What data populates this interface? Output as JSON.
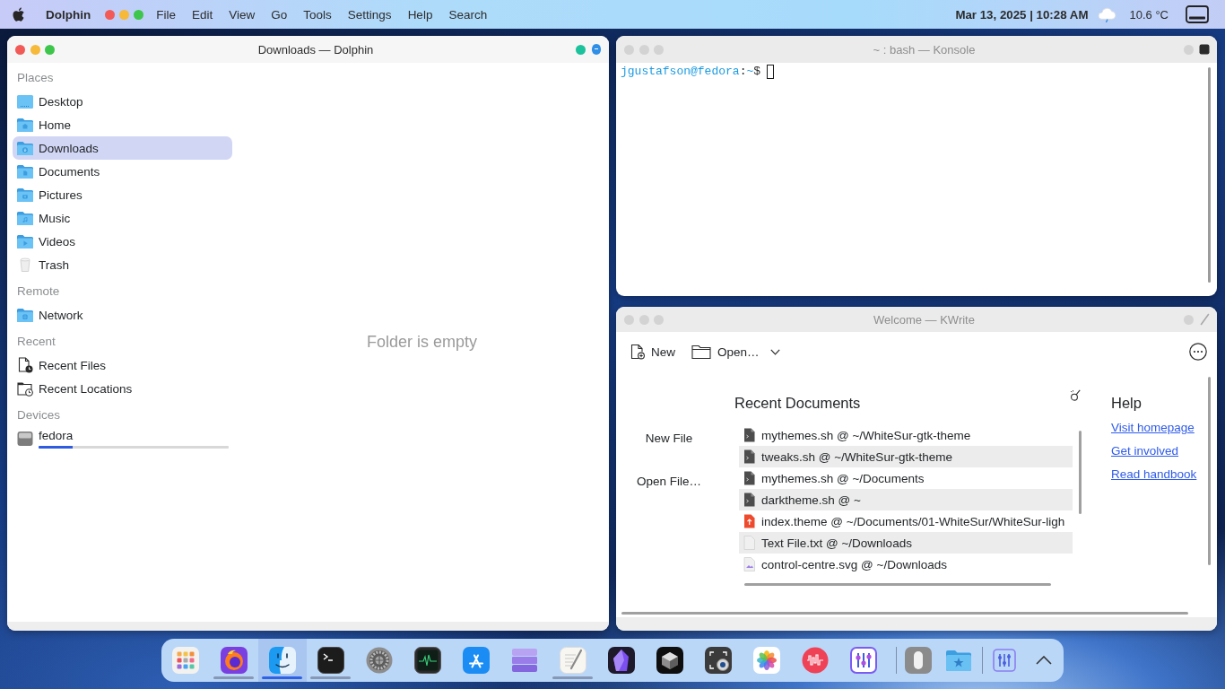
{
  "menu_bar": {
    "app_name": "Dolphin",
    "menus": [
      "File",
      "Edit",
      "View",
      "Go",
      "Tools",
      "Settings",
      "Help",
      "Search"
    ],
    "clock": "Mar 13, 2025 | 10:28 AM",
    "temperature": "10.6 °C"
  },
  "windows": [
    {
      "kind": "files",
      "title": "Downloads — Dolphin",
      "active": true,
      "sidebar": [
        {
          "heading": "Places",
          "items": [
            {
              "kind": "desktop",
              "label": "Desktop",
              "selected": false
            },
            {
              "kind": "home",
              "label": "Home",
              "selected": false
            },
            {
              "kind": "downloads",
              "label": "Downloads",
              "selected": true
            },
            {
              "kind": "documents",
              "label": "Documents",
              "selected": false
            },
            {
              "kind": "pictures",
              "label": "Pictures",
              "selected": false
            },
            {
              "kind": "music",
              "label": "Music",
              "selected": false
            },
            {
              "kind": "videos",
              "label": "Videos",
              "selected": false
            },
            {
              "kind": "trash",
              "label": "Trash",
              "selected": false
            }
          ]
        },
        {
          "heading": "Remote",
          "items": [
            {
              "kind": "network",
              "label": "Network",
              "selected": false
            }
          ]
        },
        {
          "heading": "Recent",
          "items": [
            {
              "kind": "recentfiles",
              "label": "Recent Files",
              "selected": false
            },
            {
              "kind": "recentlocations",
              "label": "Recent Locations",
              "selected": false
            }
          ]
        },
        {
          "heading": "Devices",
          "items": [
            {
              "kind": "drive",
              "label": "fedora",
              "selected": false,
              "level": 0.18
            }
          ]
        }
      ],
      "empty_message": "Folder is empty"
    },
    {
      "kind": "terminal",
      "title": "~ : bash — Konsole",
      "active": false,
      "prompt": [
        {
          "kind": "user",
          "text": "jgustafson@fedora"
        },
        {
          "kind": "plain",
          "text": ":"
        },
        {
          "kind": "path",
          "text": "~"
        },
        {
          "kind": "plain",
          "text": "$"
        }
      ]
    },
    {
      "kind": "editor",
      "title": "Welcome — KWrite",
      "active": false,
      "toolbar": [
        {
          "kind": "new",
          "label": "New"
        },
        {
          "kind": "open",
          "label": "Open…"
        }
      ],
      "actions": [
        "New File",
        "Open File…"
      ],
      "recent_heading": "Recent Documents",
      "recent": [
        {
          "kind": "script",
          "label": "mythemes.sh @ ~/WhiteSur-gtk-theme"
        },
        {
          "kind": "script",
          "label": "tweaks.sh @ ~/WhiteSur-gtk-theme"
        },
        {
          "kind": "script",
          "label": "mythemes.sh @ ~/Documents"
        },
        {
          "kind": "script",
          "label": "darktheme.sh @ ~"
        },
        {
          "kind": "theme",
          "label": "index.theme @ ~/Documents/01-WhiteSur/WhiteSur-ligh"
        },
        {
          "kind": "text",
          "label": "Text File.txt @ ~/Downloads"
        },
        {
          "kind": "image",
          "label": "control-centre.svg @ ~/Downloads"
        }
      ],
      "help_heading": "Help",
      "help_links": [
        "Visit homepage",
        "Get involved",
        "Read handbook"
      ]
    }
  ],
  "dock": {
    "groups": [
      {
        "items": [
          {
            "kind": "launchpad",
            "running": false,
            "selected": false
          },
          {
            "kind": "browser",
            "running": true,
            "selected": false
          },
          {
            "kind": "finder",
            "running": true,
            "selected": true
          },
          {
            "kind": "terminal",
            "running": true,
            "selected": false
          },
          {
            "kind": "settings",
            "running": false,
            "selected": false
          },
          {
            "kind": "monitor",
            "running": false,
            "selected": false
          },
          {
            "kind": "appstore",
            "running": false,
            "selected": false
          },
          {
            "kind": "layers",
            "running": false,
            "selected": false
          },
          {
            "kind": "notes",
            "running": true,
            "selected": false
          },
          {
            "kind": "crystal",
            "running": false,
            "selected": false
          },
          {
            "kind": "cube",
            "running": false,
            "selected": false
          },
          {
            "kind": "screenshot",
            "running": false,
            "selected": false
          },
          {
            "kind": "photos",
            "running": false,
            "selected": false
          },
          {
            "kind": "audio",
            "running": false,
            "selected": false
          },
          {
            "kind": "mixer",
            "running": false,
            "selected": false
          }
        ]
      },
      {
        "items": [
          {
            "kind": "mouse",
            "running": false,
            "selected": false
          },
          {
            "kind": "folder",
            "running": false,
            "selected": false
          }
        ]
      },
      {
        "items": [
          {
            "kind": "sliders",
            "running": false,
            "selected": false
          },
          {
            "kind": "caret",
            "running": false,
            "selected": false
          }
        ]
      }
    ]
  }
}
